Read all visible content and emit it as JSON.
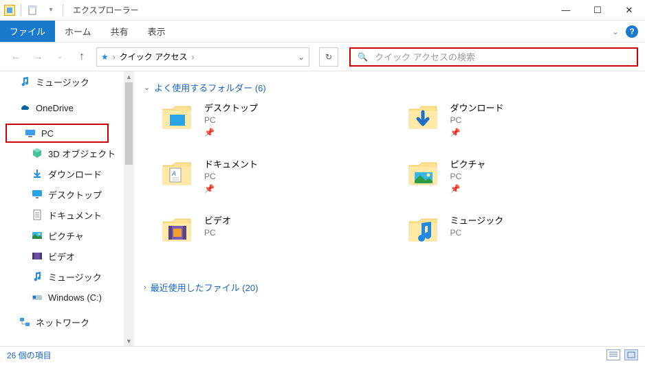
{
  "window": {
    "title": "エクスプローラー",
    "minimize": "—",
    "maximize": "☐",
    "close": "✕"
  },
  "ribbon": {
    "tabs": {
      "file": "ファイル",
      "home": "ホーム",
      "share": "共有",
      "view": "表示"
    },
    "chevron": "⌄",
    "help": "?"
  },
  "nav": {
    "back": "←",
    "forward": "→",
    "recent_drop": "⌄",
    "up": "↑",
    "refresh": "↻"
  },
  "address": {
    "star": "★",
    "sep": "›",
    "crumb": "クイック アクセス",
    "dropdown": "⌄"
  },
  "search": {
    "icon": "🔍",
    "placeholder": "クイック アクセスの検索"
  },
  "tree": {
    "music_top": "ミュージック",
    "onedrive": "OneDrive",
    "pc": "PC",
    "objects3d": "3D オブジェクト",
    "downloads": "ダウンロード",
    "desktop": "デスクトップ",
    "documents": "ドキュメント",
    "pictures": "ピクチャ",
    "videos": "ビデオ",
    "music": "ミュージック",
    "cdrive": "Windows (C:)",
    "network": "ネットワーク"
  },
  "sections": {
    "frequent": {
      "chev": "⌄",
      "label": "よく使用するフォルダー (6)"
    },
    "recent": {
      "chev": "›",
      "label": "最近使用したファイル (20)"
    }
  },
  "folders": {
    "desktop": {
      "name": "デスクトップ",
      "sub": "PC",
      "pin": "📌"
    },
    "downloads": {
      "name": "ダウンロード",
      "sub": "PC",
      "pin": "📌"
    },
    "documents": {
      "name": "ドキュメント",
      "sub": "PC",
      "pin": "📌"
    },
    "pictures": {
      "name": "ピクチャ",
      "sub": "PC",
      "pin": "📌"
    },
    "videos": {
      "name": "ビデオ",
      "sub": "PC",
      "pin": ""
    },
    "music": {
      "name": "ミュージック",
      "sub": "PC",
      "pin": ""
    }
  },
  "status": {
    "text": "26 個の項目"
  },
  "colors": {
    "accent_blue": "#1979ca",
    "highlight_red": "#cc0000"
  }
}
